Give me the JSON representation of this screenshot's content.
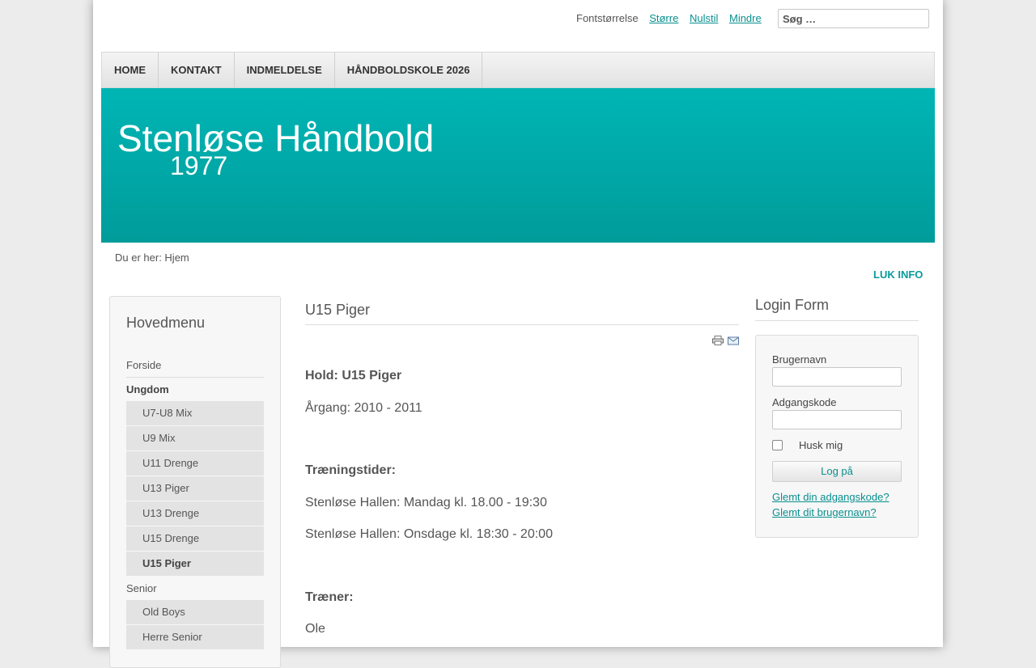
{
  "topbar": {
    "fontsize_label": "Fontstørrelse",
    "larger": "Større",
    "reset": "Nulstil",
    "smaller": "Mindre",
    "search_placeholder": "Søg …"
  },
  "nav": [
    "HOME",
    "KONTAKT",
    "INDMELDELSE",
    "HÅNDBOLDSKOLE 2026"
  ],
  "header": {
    "title": "Stenløse Håndbold",
    "subtitle": "1977"
  },
  "breadcrumb": "Du er her: Hjem",
  "info_toggle": "LUK INFO",
  "sidebar": {
    "title": "Hovedmenu",
    "items": {
      "forside": "Forside",
      "ungdom": "Ungdom",
      "ungdom_sub": [
        "U7-U8 Mix",
        "U9 Mix",
        "U11 Drenge",
        "U13 Piger",
        "U13 Drenge",
        "U15 Drenge",
        "U15 Piger"
      ],
      "senior": "Senior",
      "senior_sub": [
        "Old Boys",
        "Herre Senior"
      ]
    }
  },
  "content": {
    "title": "U15 Piger",
    "hold": "Hold: U15 Piger",
    "aargang": "Årgang: 2010 - 2011",
    "traening_heading": "Træningstider:",
    "traening_1": "Stenløse Hallen: Mandag kl. 18.00 - 19:30",
    "traening_2": "Stenløse Hallen: Onsdage kl. 18:30 - 20:00",
    "traener_heading": "Træner:",
    "traener": "Ole"
  },
  "login": {
    "title": "Login Form",
    "username_label": "Brugernavn",
    "password_label": "Adgangskode",
    "remember": "Husk mig",
    "button": "Log på",
    "forgot_password": "Glemt din adgangskode?",
    "forgot_username": "Glemt dit brugernavn?"
  }
}
